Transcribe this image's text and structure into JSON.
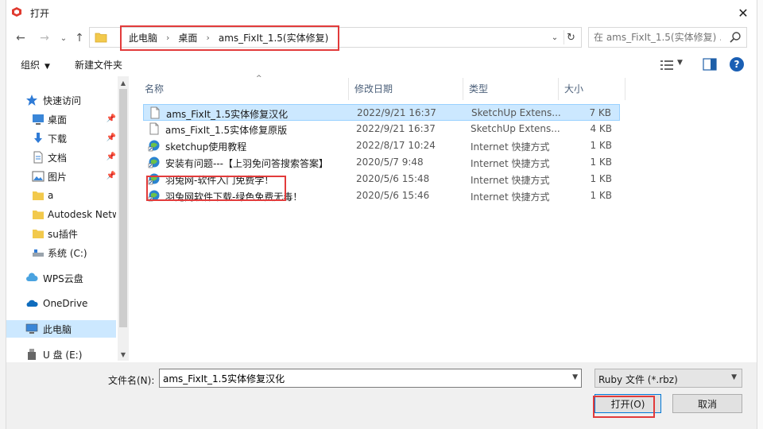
{
  "window": {
    "title": "打开",
    "close_glyph": "✕"
  },
  "nav": {
    "back_glyph": "←",
    "forward_glyph": "→",
    "recent_glyph": "⌄",
    "up_glyph": "↑"
  },
  "address": {
    "crumbs": [
      "此电脑",
      "桌面",
      "ams_FixIt_1.5(实体修复)"
    ],
    "separator": "›",
    "dropdown_glyph": "⌄",
    "refresh_glyph": "↻"
  },
  "search": {
    "placeholder": "在 ams_FixIt_1.5(实体修复) ..."
  },
  "toolbar": {
    "organize_label": "组织",
    "organize_caret": "▼",
    "new_folder_label": "新建文件夹",
    "view_caret": "▼",
    "help_label": "?"
  },
  "sidebar": {
    "items": [
      {
        "label": "快速访问",
        "icon": "star-icon"
      },
      {
        "label": "桌面",
        "icon": "desktop-icon",
        "pinned": true
      },
      {
        "label": "下载",
        "icon": "download-icon",
        "pinned": true
      },
      {
        "label": "文档",
        "icon": "document-icon",
        "pinned": true
      },
      {
        "label": "图片",
        "icon": "picture-icon",
        "pinned": true
      },
      {
        "label": "a",
        "icon": "folder-icon"
      },
      {
        "label": "Autodesk Netw",
        "icon": "folder-icon"
      },
      {
        "label": "su插件",
        "icon": "folder-icon"
      },
      {
        "label": "系统 (C:)",
        "icon": "drive-icon"
      },
      {
        "label": "WPS云盘",
        "icon": "wps-cloud-icon"
      },
      {
        "label": "OneDrive",
        "icon": "onedrive-icon"
      },
      {
        "label": "此电脑",
        "icon": "computer-icon"
      },
      {
        "label": "U 盘 (E:)",
        "icon": "usb-drive-icon"
      }
    ],
    "pin_glyph": "📌",
    "scroll_up_glyph": "▲",
    "scroll_down_glyph": "▼"
  },
  "columns": {
    "name": "名称",
    "modified": "修改日期",
    "type": "类型",
    "size": "大小",
    "sort_glyph": "^"
  },
  "files": [
    {
      "name": "ams_FixIt_1.5实体修复汉化",
      "date": "2022/9/21 16:37",
      "type": "SketchUp Extens...",
      "size": "7 KB",
      "icon": "file-icon"
    },
    {
      "name": "ams_FixIt_1.5实体修复原版",
      "date": "2022/9/21 16:37",
      "type": "SketchUp Extens...",
      "size": "4 KB",
      "icon": "file-icon"
    },
    {
      "name": "sketchup使用教程",
      "date": "2022/8/17 10:24",
      "type": "Internet 快捷方式",
      "size": "1 KB",
      "icon": "internet-shortcut-icon"
    },
    {
      "name": "安装有问题---【上羽免问答搜索答案】",
      "date": "2020/5/7 9:48",
      "type": "Internet 快捷方式",
      "size": "1 KB",
      "icon": "internet-shortcut-icon"
    },
    {
      "name": "羽兔网-软件入门免费学！",
      "date": "2020/5/6 15:48",
      "type": "Internet 快捷方式",
      "size": "1 KB",
      "icon": "internet-shortcut-icon"
    },
    {
      "name": "羽兔网软件下载-绿色免费无毒！",
      "date": "2020/5/6 15:46",
      "type": "Internet 快捷方式",
      "size": "1 KB",
      "icon": "internet-shortcut-icon"
    }
  ],
  "bottom": {
    "filename_label": "文件名(N):",
    "filename_value": "ams_FixIt_1.5实体修复汉化",
    "filename_caret": "▼",
    "filetype_value": "Ruby 文件 (*.rbz)",
    "filetype_caret": "▼",
    "open_label": "打开(O)",
    "cancel_label": "取消"
  },
  "colors": {
    "selection": "#cce8ff",
    "highlight_box": "#e23b3b",
    "accent": "#0078d7"
  }
}
